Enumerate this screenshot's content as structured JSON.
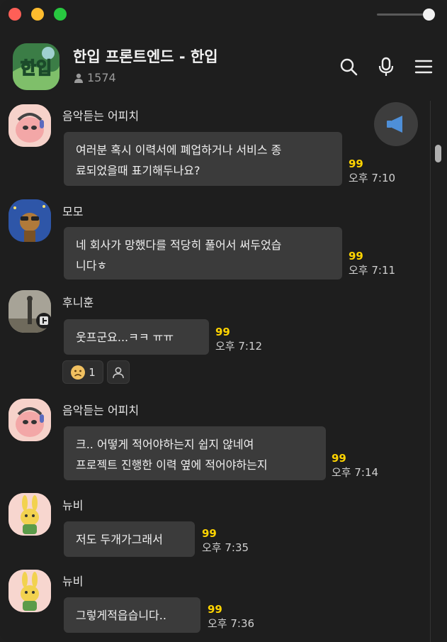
{
  "window": {
    "controls": [
      "close-button",
      "minimize-button",
      "zoom-button"
    ],
    "opacity_slider_value": 1.0
  },
  "room": {
    "avatar_text": "한입",
    "title": "한입 프론트엔드 - 한입",
    "member_count": "1574"
  },
  "header_icons": [
    "search-icon",
    "microphone-icon",
    "menu-icon"
  ],
  "notice_icon": "megaphone-icon",
  "messages": [
    {
      "sender": "음악듣는 어피치",
      "lines": [
        "여러분 혹시 이력서에 폐업하거나 서비스 종",
        "료되었을때 표기해두나요?"
      ],
      "unread": "99",
      "time": "오후 7:10"
    },
    {
      "sender": "모모",
      "lines": [
        "네 회사가 망했다를 적당히 풀어서 써두었습",
        "니다ㅎ"
      ],
      "unread": "99",
      "time": "오후 7:11"
    },
    {
      "sender": "후니훈",
      "lines": [
        "웃프군요...ㅋㅋ ㅠㅠ"
      ],
      "unread": "99",
      "time": "오후 7:12",
      "reactions": [
        {
          "icon": "sad-face-icon",
          "count": "1"
        },
        {
          "icon": "person-icon",
          "count": ""
        }
      ]
    },
    {
      "sender": "음악듣는 어피치",
      "lines": [
        "크.. 어떻게 적어야하는지 쉽지 않네여",
        "프로젝트 진행한 이력 옆에 적어야하는지"
      ],
      "unread": "99",
      "time": "오후 7:14"
    },
    {
      "sender": "뉴비",
      "lines": [
        "저도 두개가그래서"
      ],
      "unread": "99",
      "time": "오후 7:35"
    },
    {
      "sender": "뉴비",
      "lines": [
        "그렇게적읍습니다.."
      ],
      "unread": "99",
      "time": "오후 7:36"
    }
  ],
  "colors": {
    "background": "#1e1e1e",
    "bubble": "#3b3b3b",
    "unread": "#ffd400"
  }
}
